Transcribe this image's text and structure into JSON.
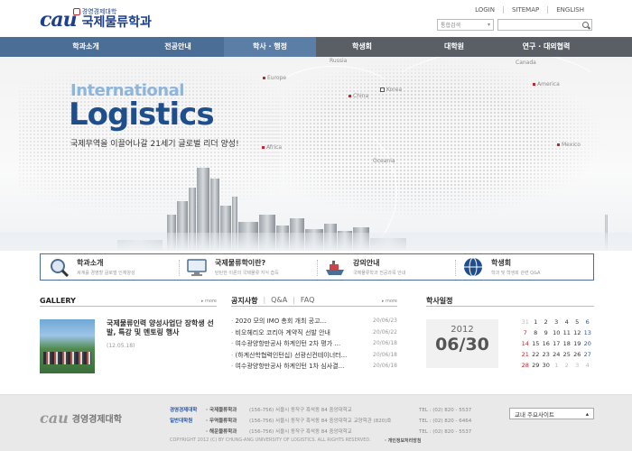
{
  "header": {
    "logo_mark": "cau",
    "logo_sub": "경영경제대학",
    "logo_main": "국제물류학과",
    "util_links": [
      "LOGIN",
      "SITEMAP",
      "ENGLISH"
    ],
    "search_select": "통합검색",
    "search_placeholder": ""
  },
  "nav": {
    "items": [
      "학과소개",
      "전공안내",
      "학사 · 행정",
      "학생회",
      "대학원",
      "연구 · 대외협력"
    ]
  },
  "hero": {
    "title_small": "International",
    "title_big": "Logistics",
    "slogan": "국제무역을 이끌어나갈 21세기 글로벌 리더 양성!",
    "cities": [
      "Europe",
      "Russia",
      "China",
      "Korea",
      "Canada",
      "America",
      "Africa",
      "Oceania",
      "Mexico"
    ]
  },
  "quick": [
    {
      "title": "학과소개",
      "desc": "세계를 경영할 글로벌 인재양성"
    },
    {
      "title": "국제물류학이란?",
      "desc": "탄탄한 이론의 국제물류 지식 습득"
    },
    {
      "title": "강의안내",
      "desc": "국제물류학과 전공과목 안내"
    },
    {
      "title": "학생회",
      "desc": "학과 및 학생회 관련 Q&A"
    }
  ],
  "gallery": {
    "title": "GALLERY",
    "more": "more",
    "item_title": "국제물류인력 양성사업단 장학생 선발, 특강 및 멘토링 행사",
    "item_date": "(12.05.18)"
  },
  "notice": {
    "tabs": [
      "공지사항",
      "Q&A",
      "FAQ"
    ],
    "more": "more",
    "items": [
      {
        "text": "2020 모의 IMO 총회 개최 공고...",
        "date": "20/06/23"
      },
      {
        "text": "비오헤리오 코리아 계약직 선발 안내",
        "date": "20/06/22"
      },
      {
        "text": "여수광양항만공사 하계인턴 2차 평가 ...",
        "date": "20/06/18"
      },
      {
        "text": "(하계산학협력인턴십) 선광신컨테이너터...",
        "date": "20/06/18"
      },
      {
        "text": "여수광양항만공사 하계인턴 1차 심사결...",
        "date": "20/06/18"
      }
    ]
  },
  "schedule": {
    "title": "학사일정",
    "year": "2012",
    "day": "06/30",
    "calendar": [
      [
        "31",
        "1",
        "2",
        "3",
        "4",
        "5",
        "6"
      ],
      [
        "7",
        "8",
        "9",
        "10",
        "11",
        "12",
        "13"
      ],
      [
        "14",
        "15",
        "16",
        "17",
        "18",
        "19",
        "20"
      ],
      [
        "21",
        "22",
        "23",
        "24",
        "25",
        "26",
        "27"
      ],
      [
        "28",
        "29",
        "30",
        "1",
        "2",
        "3",
        "4"
      ]
    ]
  },
  "footer": {
    "logo_mark": "cau",
    "logo_name": "경영경제대학",
    "rows": [
      {
        "a": "경영경제대학",
        "b": "· 국제물류학과",
        "c": "(156-756) 서울시 동작구 흑석동 84 중앙대학교",
        "d": "TEL : (02) 820 - 5537"
      },
      {
        "a": "일반대학원",
        "b": "· 무역물류학과",
        "c": "(156-756) 서울시 동작구 흑석동 84 중앙대학교 교양학관 (820)호",
        "d": "TEL : (02) 820 - 6464"
      },
      {
        "a": "",
        "b": "· 해운물류학과",
        "c": "(156-756) 서울시 동작구 흑석동 84 중앙대학교",
        "d": "TEL : (02) 820 - 5537"
      }
    ],
    "copyright": "COPYRIGHT 2012 (C) BY CHUNG-ANG UNIVERSITY OF LOGISTICS. ALL RIGHTS RESERVED.",
    "privacy": "· 개인정보처리방침",
    "site_select": "교내 주요사이트"
  }
}
